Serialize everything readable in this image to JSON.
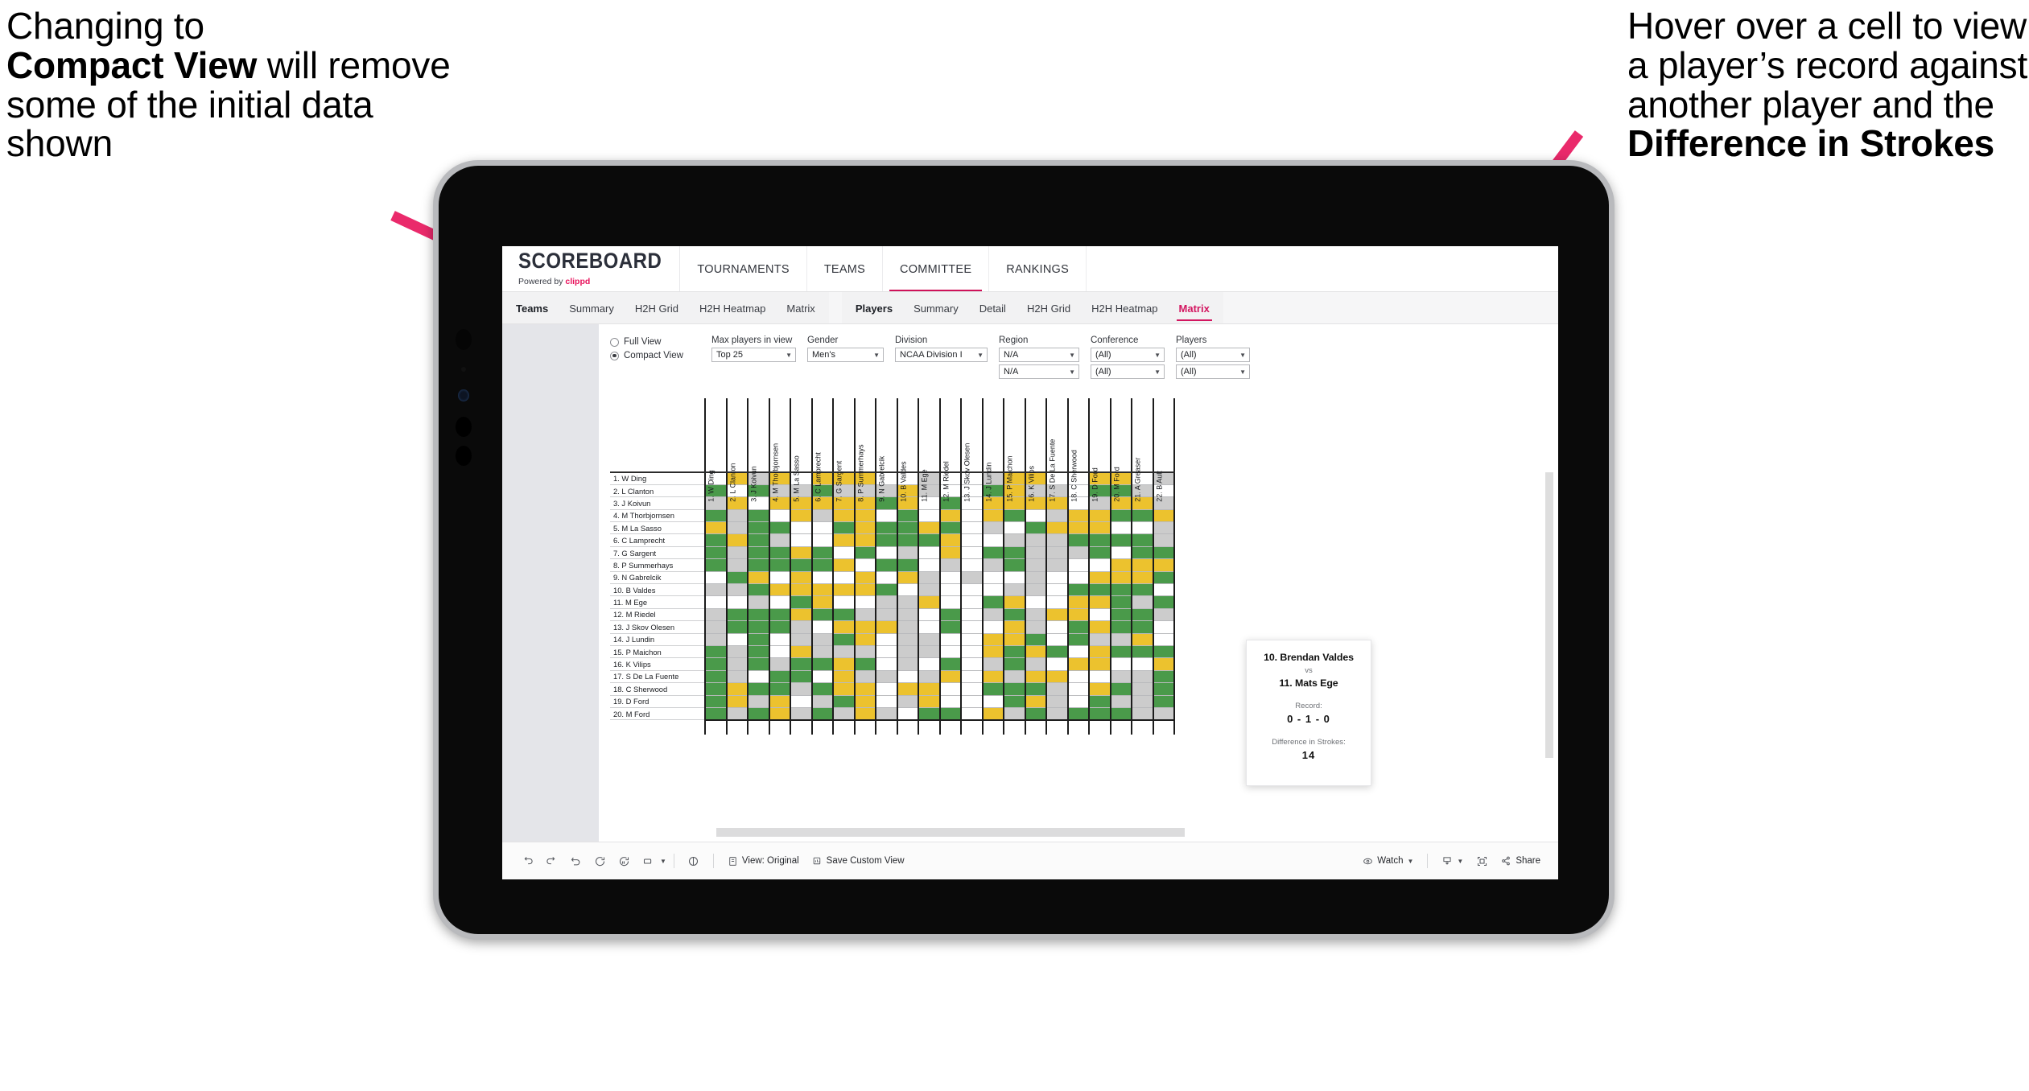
{
  "annotations": {
    "left": {
      "line1": "Changing to",
      "bold": "Compact View",
      "line2": " will remove some of the initial data shown"
    },
    "right": {
      "line1": "Hover over a cell to view a player’s record against another player and the ",
      "bold": "Difference in Strokes"
    },
    "arrow_color": "#ea2a6b"
  },
  "brand": {
    "name": "SCOREBOARD",
    "powered_prefix": "Powered by ",
    "powered_accent": "clippd"
  },
  "topnav": {
    "items": [
      {
        "label": "TOURNAMENTS",
        "active": false
      },
      {
        "label": "TEAMS",
        "active": false
      },
      {
        "label": "COMMITTEE",
        "active": true
      },
      {
        "label": "RANKINGS",
        "active": false
      }
    ]
  },
  "subnav": {
    "group_teams": {
      "head": "Teams",
      "items": [
        "Summary",
        "H2H Grid",
        "H2H Heatmap",
        "Matrix"
      ]
    },
    "group_players": {
      "head": "Players",
      "items": [
        "Summary",
        "Detail",
        "H2H Grid",
        "H2H Heatmap"
      ],
      "selected": "Matrix"
    }
  },
  "filters": {
    "view_mode": {
      "full": "Full View",
      "compact": "Compact View",
      "selected": "compact"
    },
    "max_players": {
      "label": "Max players in view",
      "value": "Top 25"
    },
    "gender": {
      "label": "Gender",
      "value": "Men's"
    },
    "division": {
      "label": "Division",
      "value": "NCAA Division I"
    },
    "region": {
      "label": "Region",
      "value": "N/A",
      "value2": "N/A"
    },
    "conference": {
      "label": "Conference",
      "value": "(All)",
      "value2": "(All)"
    },
    "players": {
      "label": "Players",
      "value": "(All)",
      "value2": "(All)"
    }
  },
  "matrix": {
    "row_labels": [
      "1. W Ding",
      "2. L Clanton",
      "3. J Koivun",
      "4. M Thorbjornsen",
      "5. M La Sasso",
      "6. C Lamprecht",
      "7. G Sargent",
      "8. P Summerhays",
      "9. N Gabrelcik",
      "10. B Valdes",
      "11. M Ege",
      "12. M Riedel",
      "13. J Skov Olesen",
      "14. J Lundin",
      "15. P Maichon",
      "16. K Vilips",
      "17. S De La Fuente",
      "18. C Sherwood",
      "19. D Ford",
      "20. M Ford"
    ],
    "col_labels": [
      "1. W Ding",
      "2. L Clanton",
      "3. J Koivun",
      "4. M Thorbjornsen",
      "5. M La Sasso",
      "6. C Lamprecht",
      "7. G Sargent",
      "8. P Summerhays",
      "9. N Gabrelcik",
      "10. B Valdes",
      "11. M Ege",
      "12. M Riedel",
      "13. J Skov Olesen",
      "14. J Lundin",
      "15. P Maichon",
      "16. K Vilips",
      "17. S De La Fuente",
      "18. C Sherwood",
      "19. D Ford",
      "20. M Ford",
      "21. A Greaser",
      "22. B Ault"
    ],
    "colors": {
      "win": "#4a9a4a",
      "tie": "#ecc22e",
      "loss": "#cccccc",
      "none": "#ffffff"
    },
    "legend_key": {
      "w": "win",
      "y": "tie",
      "g": "loss",
      "n": "none"
    },
    "cells": [
      "nygynyyynngn gyynnyyngyy",
      "wnwggwgggygn wyggnwwgnnw",
      "gynyyyyywynw yyyyngyyggy",
      "wgwnygyynwny ywngyywwyyw",
      "ygwwnnwywwyw gnwyyynngnw",
      "wywgnnyywwwy ngggwwwwgyy",
      "wgwwywnwngny wwgggwnwwgy",
      "wgwwwwynwwng gwggnnyyyyy",
      "nwynynnynyg g ngnnyyywgy",
      "ggwyyyyywngn nggnwwwwngg",
      "nngnwynnggyn wynnyywgwww",
      "gwwwywwgggnw gwgyynwwgww",
      "gwwwgnyyygnw nygnwywwngw",
      "gnwnggwynggn yywnwggynww",
      "wgwnygggnggn ywywnywwwgw",
      "wgwgwwywngnw gwgnyynnyww",
      "wgnwwnyggngy ygyynnggwww",
      "wywwgwyynyyn wwwgnywgwgg",
      "wygyngwyngyn nwygnwggwgw",
      "wgwygwgygnww ygwgwwwgggn"
    ]
  },
  "tooltip": {
    "player_a": "10. Brendan Valdes",
    "vs": "vs",
    "player_b": "11. Mats Ege",
    "record_label": "Record:",
    "record_value": "0 - 1 - 0",
    "diff_label": "Difference in Strokes:",
    "diff_value": "14"
  },
  "bottombar": {
    "view_button": "View: Original",
    "save_button": "Save Custom View",
    "watch_button": "Watch",
    "share_button": "Share"
  }
}
